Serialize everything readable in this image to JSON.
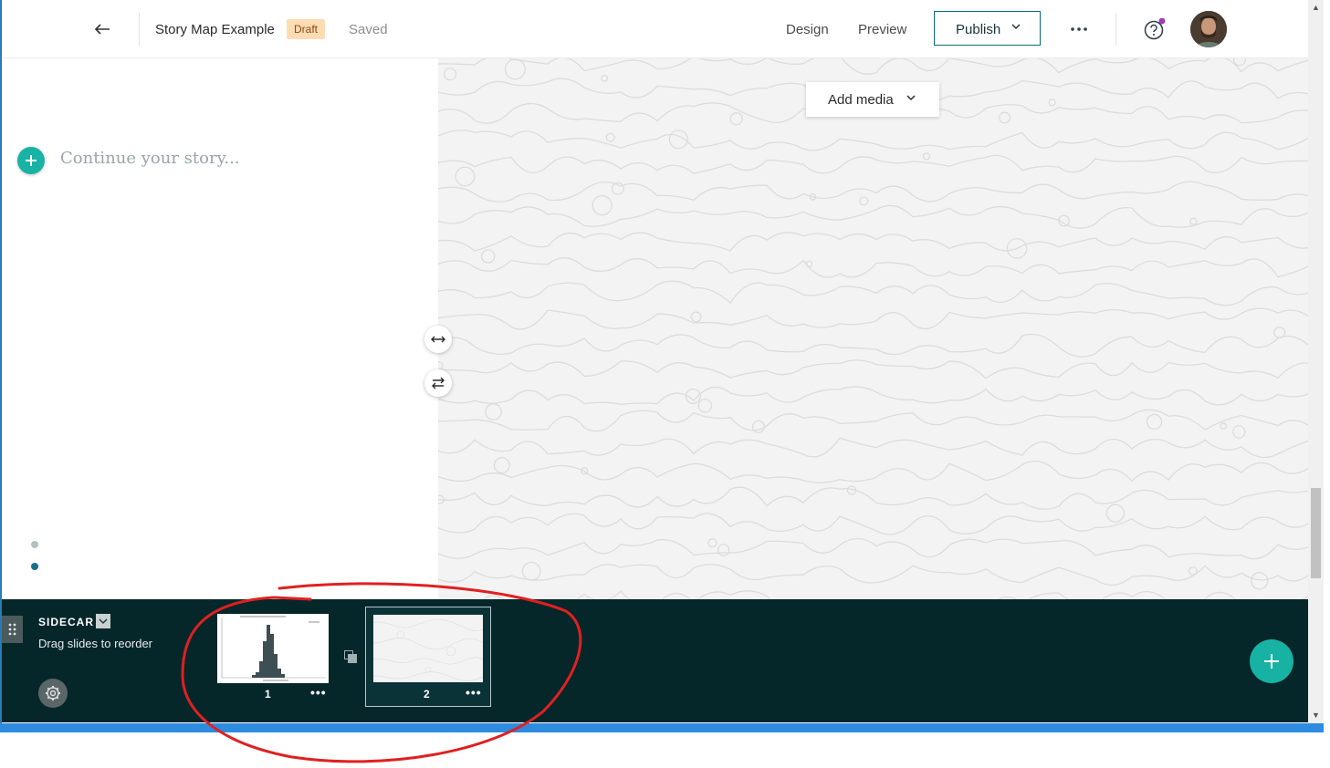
{
  "header": {
    "back_icon": "arrow-left-icon",
    "story_title": "Story Map Example",
    "draft_badge": "Draft",
    "saved_status": "Saved",
    "design_tab": "Design",
    "preview_tab": "Preview",
    "publish_label": "Publish",
    "more_icon": "more-horizontal-icon",
    "help_icon": "question-circle-icon",
    "avatar_icon": "user-avatar"
  },
  "narrative": {
    "placeholder": "Continue your story...",
    "add_icon": "plus-icon",
    "slide_dots": 2,
    "active_dot": 2
  },
  "media": {
    "add_media_label": "Add media",
    "resize_icon": "arrows-horizontal-icon",
    "swap_icon": "swap-icon"
  },
  "builder": {
    "block_label": "SIDECAR",
    "drag_hint": "Drag slides to reorder",
    "slides": [
      {
        "number": "1",
        "thumbnail": "histogram-chart"
      },
      {
        "number": "2",
        "thumbnail": "topographic-pattern"
      }
    ],
    "more_glyph": "•••",
    "selected_slide": 2
  },
  "colors": {
    "accent_teal": "#18b3a4",
    "builder_bg": "#05272a",
    "publish_border": "#0e6a7b",
    "draft_badge_bg": "#fddcb4",
    "annotation_red": "#e02020"
  }
}
